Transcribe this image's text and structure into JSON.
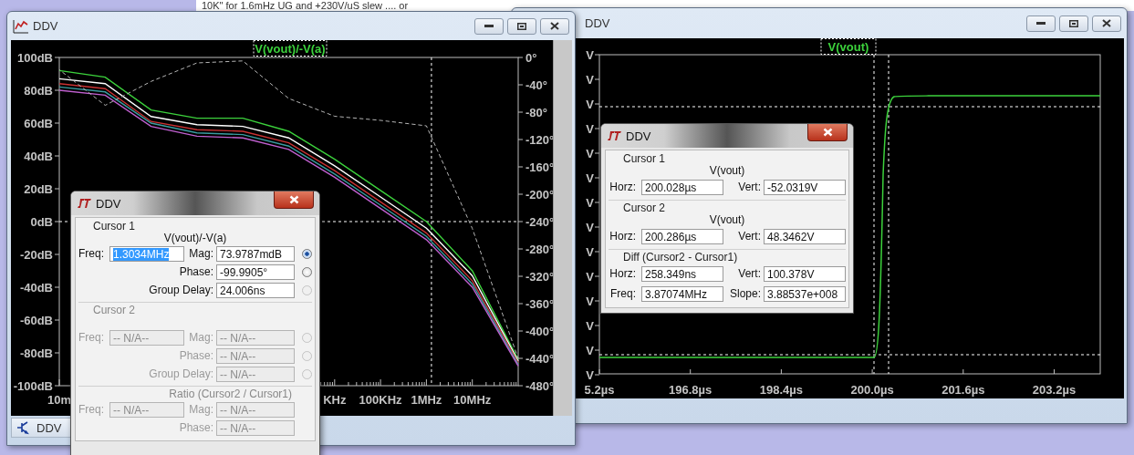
{
  "page_text": "10K\" for 1.6mHz UG and +230V/uS slew .... or",
  "bode_window": {
    "title": "DDV",
    "trace_label": "V(vout)/-V(a)",
    "magnitude": {
      "chart_data": {
        "type": "line",
        "categories": [
          "10m",
          null,
          null,
          null,
          null,
          null,
          "KHz",
          "100KHz",
          "1MHz",
          "10MHz",
          null
        ],
        "ylim": [
          -100,
          100
        ],
        "yticks": [
          {
            "value": 100,
            "label": "100dB"
          },
          {
            "value": 80,
            "label": "80dB"
          },
          {
            "value": 60,
            "label": "60dB"
          },
          {
            "value": 40,
            "label": "40dB"
          },
          {
            "value": 20,
            "label": "20dB"
          },
          {
            "value": 0,
            "label": "0dB"
          },
          {
            "value": -20,
            "label": "-20dB"
          },
          {
            "value": -40,
            "label": "-40dB"
          },
          {
            "value": -60,
            "label": "-60dB"
          },
          {
            "value": -80,
            "label": "-80dB"
          },
          {
            "value": -100,
            "label": "-100dB"
          }
        ],
        "series": [
          {
            "color": "#3cd23c",
            "values": [
              92,
              88,
              68,
              63,
              63,
              55,
              38,
              19,
              0,
              -30,
              -84
            ]
          },
          {
            "color": "#ffffff",
            "values": [
              87,
              84,
              64,
              59,
              58,
              51,
              34,
              15,
              -4,
              -33,
              -85
            ]
          },
          {
            "color": "#c83232",
            "values": [
              84,
              81,
              61,
              56,
              55,
              48,
              31,
              12,
              -7,
              -36,
              -86
            ]
          },
          {
            "color": "#3a9ca0",
            "values": [
              82,
              79,
              60,
              54,
              53,
              46,
              29,
              10,
              -9,
              -38,
              -87
            ]
          },
          {
            "color": "#c060d0",
            "values": [
              80,
              77,
              58,
              52,
              51,
              44,
              27,
              8,
              -11,
              -40,
              -88
            ]
          }
        ]
      }
    },
    "phase": {
      "chart_data": {
        "type": "line",
        "ylim": [
          -480,
          0
        ],
        "yticks": [
          {
            "value": 0,
            "label": "0°"
          },
          {
            "value": -40,
            "label": "-40°"
          },
          {
            "value": -80,
            "label": "-80°"
          },
          {
            "value": -120,
            "label": "-120°"
          },
          {
            "value": -160,
            "label": "-160°"
          },
          {
            "value": -200,
            "label": "-200°"
          },
          {
            "value": -240,
            "label": "-240°"
          },
          {
            "value": -280,
            "label": "-280°"
          },
          {
            "value": -320,
            "label": "-320°"
          },
          {
            "value": -360,
            "label": "-360°"
          },
          {
            "value": -400,
            "label": "-400°"
          },
          {
            "value": -440,
            "label": "-440°"
          },
          {
            "value": -480,
            "label": "-480°"
          }
        ],
        "series": [
          {
            "color": "#b4b4b4",
            "line_style": "dashed",
            "values": [
              -18,
              -70,
              -35,
              -8,
              -5,
              -60,
              -86,
              -92,
              -100,
              -250,
              -440
            ]
          }
        ]
      }
    }
  },
  "minimized_tab": {
    "label": "DDV"
  },
  "bode_dialog": {
    "title": "DDV",
    "sections": [
      {
        "kind": "cursor",
        "heading": "Cursor 1",
        "trace": "V(vout)/-V(a)",
        "disabled": false,
        "rows": [
          {
            "left": {
              "label": "Freq:",
              "value": "1.3034MHz",
              "highlighted": true
            },
            "right": {
              "label": "Mag:",
              "value": "73.9787mdB"
            },
            "radio": {
              "selected": true,
              "disabled": false
            }
          },
          {
            "right": {
              "label": "Phase:",
              "value": "-99.9905°"
            },
            "radio": {
              "selected": false,
              "disabled": false
            }
          },
          {
            "right": {
              "label": "Group Delay:",
              "value": "24.006ns"
            },
            "radio": {
              "selected": false,
              "disabled": true
            }
          }
        ]
      },
      {
        "kind": "cursor",
        "heading": "Cursor 2",
        "disabled": true,
        "rows": [
          {
            "left": {
              "label": "Freq:",
              "value": "-- N/A--",
              "highlighted": false
            },
            "right": {
              "label": "Mag:",
              "value": "-- N/A--"
            },
            "radio": {
              "selected": false,
              "disabled": true
            }
          },
          {
            "right": {
              "label": "Phase:",
              "value": "-- N/A--"
            },
            "radio": {
              "selected": false,
              "disabled": true
            }
          },
          {
            "right": {
              "label": "Group Delay:",
              "value": "-- N/A--"
            },
            "radio": {
              "selected": false,
              "disabled": true
            }
          }
        ]
      },
      {
        "kind": "ratio",
        "heading": "Ratio (Cursor2 / Cursor1)",
        "disabled": true,
        "rows": [
          {
            "left": {
              "label": "Freq:",
              "value": "-- N/A--",
              "highlighted": false
            },
            "right": {
              "label": "Mag:",
              "value": "-- N/A--"
            }
          },
          {
            "right": {
              "label": "Phase:",
              "value": "-- N/A--"
            }
          }
        ]
      }
    ]
  },
  "transient_window": {
    "title": "DDV",
    "trace_label": "V(vout)",
    "y_axis_labels": [
      "V",
      "V",
      "V",
      "V",
      "V",
      "V",
      "V",
      "V",
      "V",
      "V",
      "V",
      "V",
      "V",
      "V"
    ],
    "x_axis_labels": [
      "5.2µs",
      "196.8µs",
      "198.4µs",
      "200.0µs",
      "201.6µs",
      "203.2µs"
    ]
  },
  "transient_dialog": {
    "title": "DDV",
    "sections": [
      {
        "kind": "cursor",
        "heading": "Cursor 1",
        "trace": "V(vout)",
        "disabled": false,
        "rows": [
          {
            "left": {
              "label": "Horz:",
              "value": "200.028µs",
              "highlighted": false
            },
            "right": {
              "label": "Vert:",
              "value": "-52.0319V"
            }
          }
        ]
      },
      {
        "kind": "cursor",
        "heading": "Cursor 2",
        "trace": "V(vout)",
        "disabled": false,
        "rows": [
          {
            "left": {
              "label": "Horz:",
              "value": "200.286µs",
              "highlighted": false
            },
            "right": {
              "label": "Vert:",
              "value": "48.3462V"
            }
          }
        ]
      },
      {
        "kind": "diff",
        "heading": "Diff (Cursor2 - Cursor1)",
        "disabled": false,
        "rows": [
          {
            "left": {
              "label": "Horz:",
              "value": "258.349ns",
              "highlighted": false
            },
            "right": {
              "label": "Vert:",
              "value": "100.378V"
            }
          },
          {
            "left": {
              "label": "Freq:",
              "value": "3.87074MHz",
              "highlighted": false
            },
            "right": {
              "label": "Slope:",
              "value": "3.88537e+008"
            }
          }
        ]
      }
    ]
  }
}
